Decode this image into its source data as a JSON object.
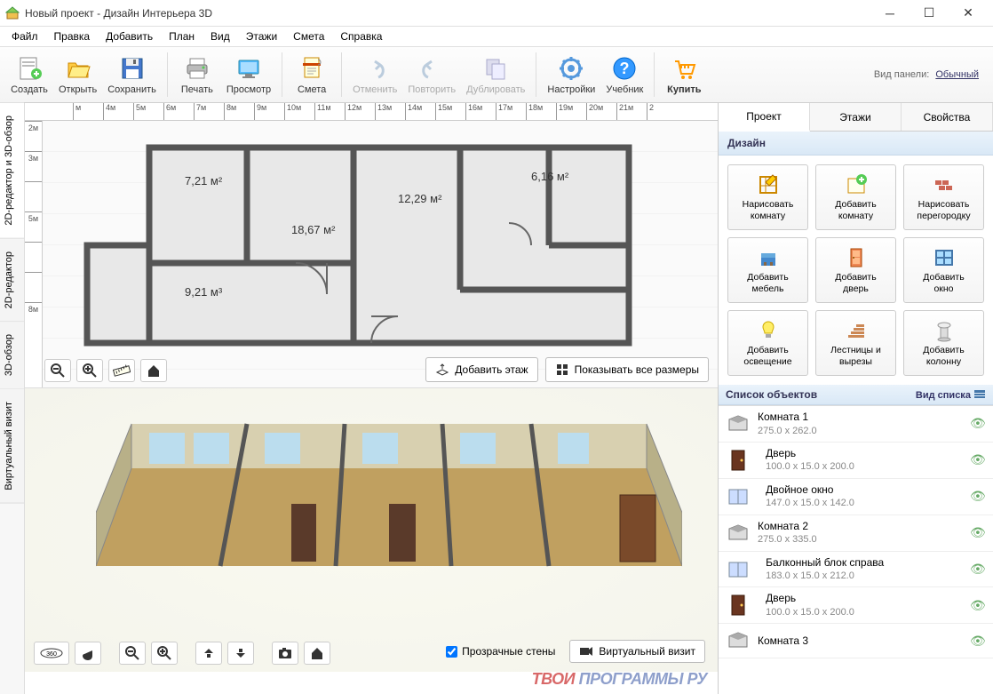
{
  "window": {
    "title": "Новый проект - Дизайн Интерьера 3D"
  },
  "menu": [
    "Файл",
    "Правка",
    "Добавить",
    "План",
    "Вид",
    "Этажи",
    "Смета",
    "Справка"
  ],
  "toolbar": {
    "create": "Создать",
    "open": "Открыть",
    "save": "Сохранить",
    "print": "Печать",
    "preview": "Просмотр",
    "estimate": "Смета",
    "undo": "Отменить",
    "redo": "Повторить",
    "duplicate": "Дублировать",
    "settings": "Настройки",
    "tutorial": "Учебник",
    "buy": "Купить",
    "panelLabel": "Вид панели:",
    "panelMode": "Обычный"
  },
  "sideTabs": [
    "2D-редактор и 3D-обзор",
    "2D-редактор",
    "3D-обзор",
    "Виртуальный визит"
  ],
  "rulerH": [
    "м",
    "4м",
    "5м",
    "6м",
    "7м",
    "8м",
    "9м",
    "10м",
    "11м",
    "12м",
    "13м",
    "14м",
    "15м",
    "16м",
    "17м",
    "18м",
    "19м",
    "20м",
    "21м",
    "2"
  ],
  "rulerV": [
    "2м",
    "3м",
    "",
    "5м",
    "",
    "",
    "8м"
  ],
  "rooms": {
    "r1": "7,21 м²",
    "r2": "18,67 м²",
    "r3": "9,21 м³",
    "r4": "12,29 м²",
    "r5": "6,16 м²"
  },
  "planBtns": {
    "addFloor": "Добавить этаж",
    "showDims": "Показывать все размеры"
  },
  "view3dControls": {
    "transparent": "Прозрачные стены",
    "virtual": "Виртуальный визит"
  },
  "rightTabs": [
    "Проект",
    "Этажи",
    "Свойства"
  ],
  "designHeader": "Дизайн",
  "tools": [
    {
      "l1": "Нарисовать",
      "l2": "комнату"
    },
    {
      "l1": "Добавить",
      "l2": "комнату"
    },
    {
      "l1": "Нарисовать",
      "l2": "перегородку"
    },
    {
      "l1": "Добавить",
      "l2": "мебель"
    },
    {
      "l1": "Добавить",
      "l2": "дверь"
    },
    {
      "l1": "Добавить",
      "l2": "окно"
    },
    {
      "l1": "Добавить",
      "l2": "освещение"
    },
    {
      "l1": "Лестницы и",
      "l2": "вырезы"
    },
    {
      "l1": "Добавить",
      "l2": "колонну"
    }
  ],
  "objectsHeader": "Список объектов",
  "listView": "Вид списка",
  "objects": [
    {
      "name": "Комната 1",
      "dims": "275.0 x 262.0",
      "type": "room"
    },
    {
      "name": "Дверь",
      "dims": "100.0 x 15.0 x 200.0",
      "type": "door"
    },
    {
      "name": "Двойное окно",
      "dims": "147.0 x 15.0 x 142.0",
      "type": "window"
    },
    {
      "name": "Комната 2",
      "dims": "275.0 x 335.0",
      "type": "room"
    },
    {
      "name": "Балконный блок справа",
      "dims": "183.0 x 15.0 x 212.0",
      "type": "window"
    },
    {
      "name": "Дверь",
      "dims": "100.0 x 15.0 x 200.0",
      "type": "door"
    },
    {
      "name": "Комната 3",
      "dims": "",
      "type": "room"
    }
  ],
  "watermark": {
    "t1": "ТВОИ ",
    "t2": "ПРОГРАММЫ РУ"
  }
}
